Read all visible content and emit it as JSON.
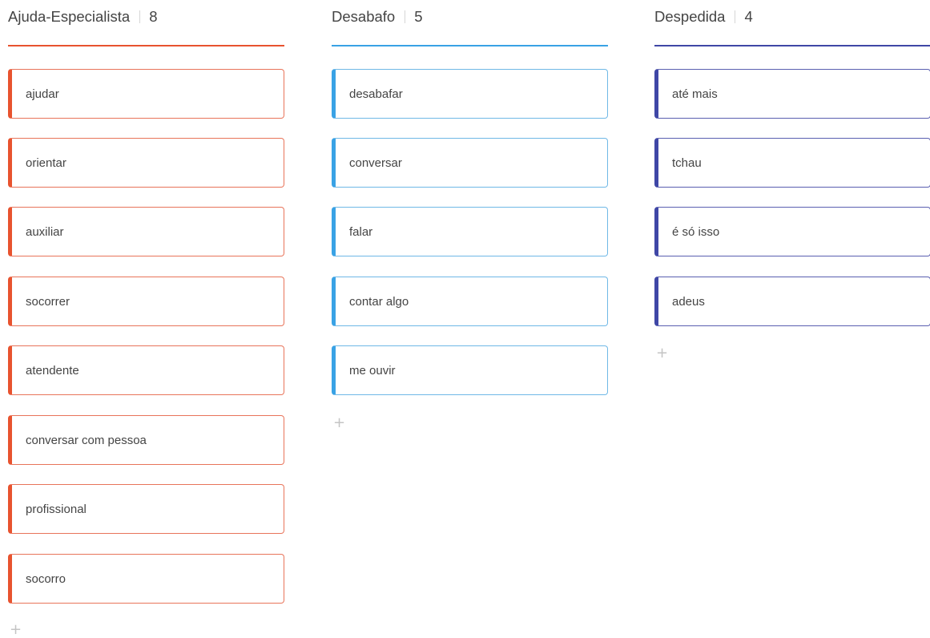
{
  "columns": [
    {
      "title": "Ajuda-Especialista",
      "count": "8",
      "color": "#e8532f",
      "border": "#e8745a",
      "cards": [
        "ajudar",
        "orientar",
        "auxiliar",
        "socorrer",
        "atendente",
        "conversar com pessoa",
        "profissional",
        "socorro"
      ],
      "add_icon": "plus-icon"
    },
    {
      "title": "Desabafo",
      "count": "5",
      "color": "#39a2e5",
      "border": "#6fb8e6",
      "cards": [
        "desabafar",
        "conversar",
        "falar",
        "contar algo",
        "me ouvir"
      ],
      "add_icon": "plus-icon"
    },
    {
      "title": "Despedida",
      "count": "4",
      "color": "#3f47a6",
      "border": "#5a5fb0",
      "cards": [
        "até mais",
        "tchau",
        "é só isso",
        "adeus"
      ],
      "add_icon": "plus-icon"
    }
  ]
}
